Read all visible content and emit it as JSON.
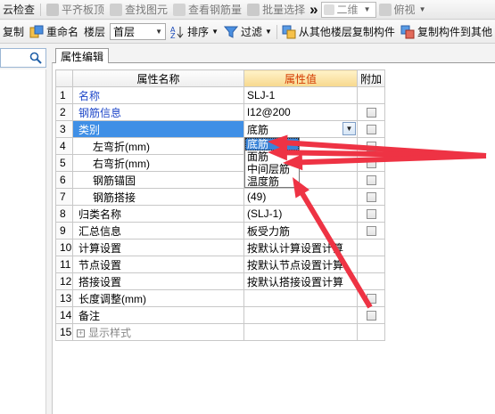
{
  "toolbar1": {
    "cloud_check": "云检查",
    "flush_top": "平齐板顶",
    "find_element": "查找图元",
    "view_rebar_qty": "查看钢筋量",
    "batch_select": "批量选择",
    "overflow": "»",
    "view_mode": "二维",
    "view_dir": "俯视"
  },
  "toolbar2": {
    "copy": "复制",
    "rename": "重命名",
    "floor_label": "楼层",
    "floor_value": "首层",
    "sort": "排序",
    "filter": "过滤",
    "copy_from_floors": "从其他楼层复制构件",
    "copy_to_floors": "复制构件到其他"
  },
  "panel": {
    "tab_label": "属性编辑",
    "col_name": "属性名称",
    "col_value": "属性值",
    "col_extra": "附加"
  },
  "rows": [
    {
      "n": "1",
      "name": "名称",
      "value": "SLJ-1",
      "check": false
    },
    {
      "n": "2",
      "name": "钢筋信息",
      "value": "ǀ12@200",
      "check": true
    },
    {
      "n": "3",
      "name": "类别",
      "value": "底筋",
      "check": true
    },
    {
      "n": "4",
      "name": "左弯折(mm)",
      "value": "",
      "check": true
    },
    {
      "n": "5",
      "name": "右弯折(mm)",
      "value": "",
      "check": true
    },
    {
      "n": "6",
      "name": "钢筋锚固",
      "value": "",
      "check": true
    },
    {
      "n": "7",
      "name": "钢筋搭接",
      "value": "(49)",
      "check": true
    },
    {
      "n": "8",
      "name": "归类名称",
      "value": "(SLJ-1)",
      "check": true
    },
    {
      "n": "9",
      "name": "汇总信息",
      "value": "板受力筋",
      "check": true
    },
    {
      "n": "10",
      "name": "计算设置",
      "value": "按默认计算设置计算",
      "check": false
    },
    {
      "n": "11",
      "name": "节点设置",
      "value": "按默认节点设置计算",
      "check": false
    },
    {
      "n": "12",
      "name": "搭接设置",
      "value": "按默认搭接设置计算",
      "check": false
    },
    {
      "n": "13",
      "name": "长度调整(mm)",
      "value": "",
      "check": true
    },
    {
      "n": "14",
      "name": "备注",
      "value": "",
      "check": true
    },
    {
      "n": "15",
      "name": "显示样式",
      "value": "",
      "check": false
    }
  ],
  "dropdown": {
    "options": [
      "底筋",
      "面筋",
      "中间层筋",
      "温度筋"
    ],
    "selected": "底筋"
  },
  "colors": {
    "accent_blue": "#3f8fe6",
    "header_highlight": "#f7d88d",
    "name_blue": "#1d46c8",
    "annotation_red": "#ee3344"
  }
}
